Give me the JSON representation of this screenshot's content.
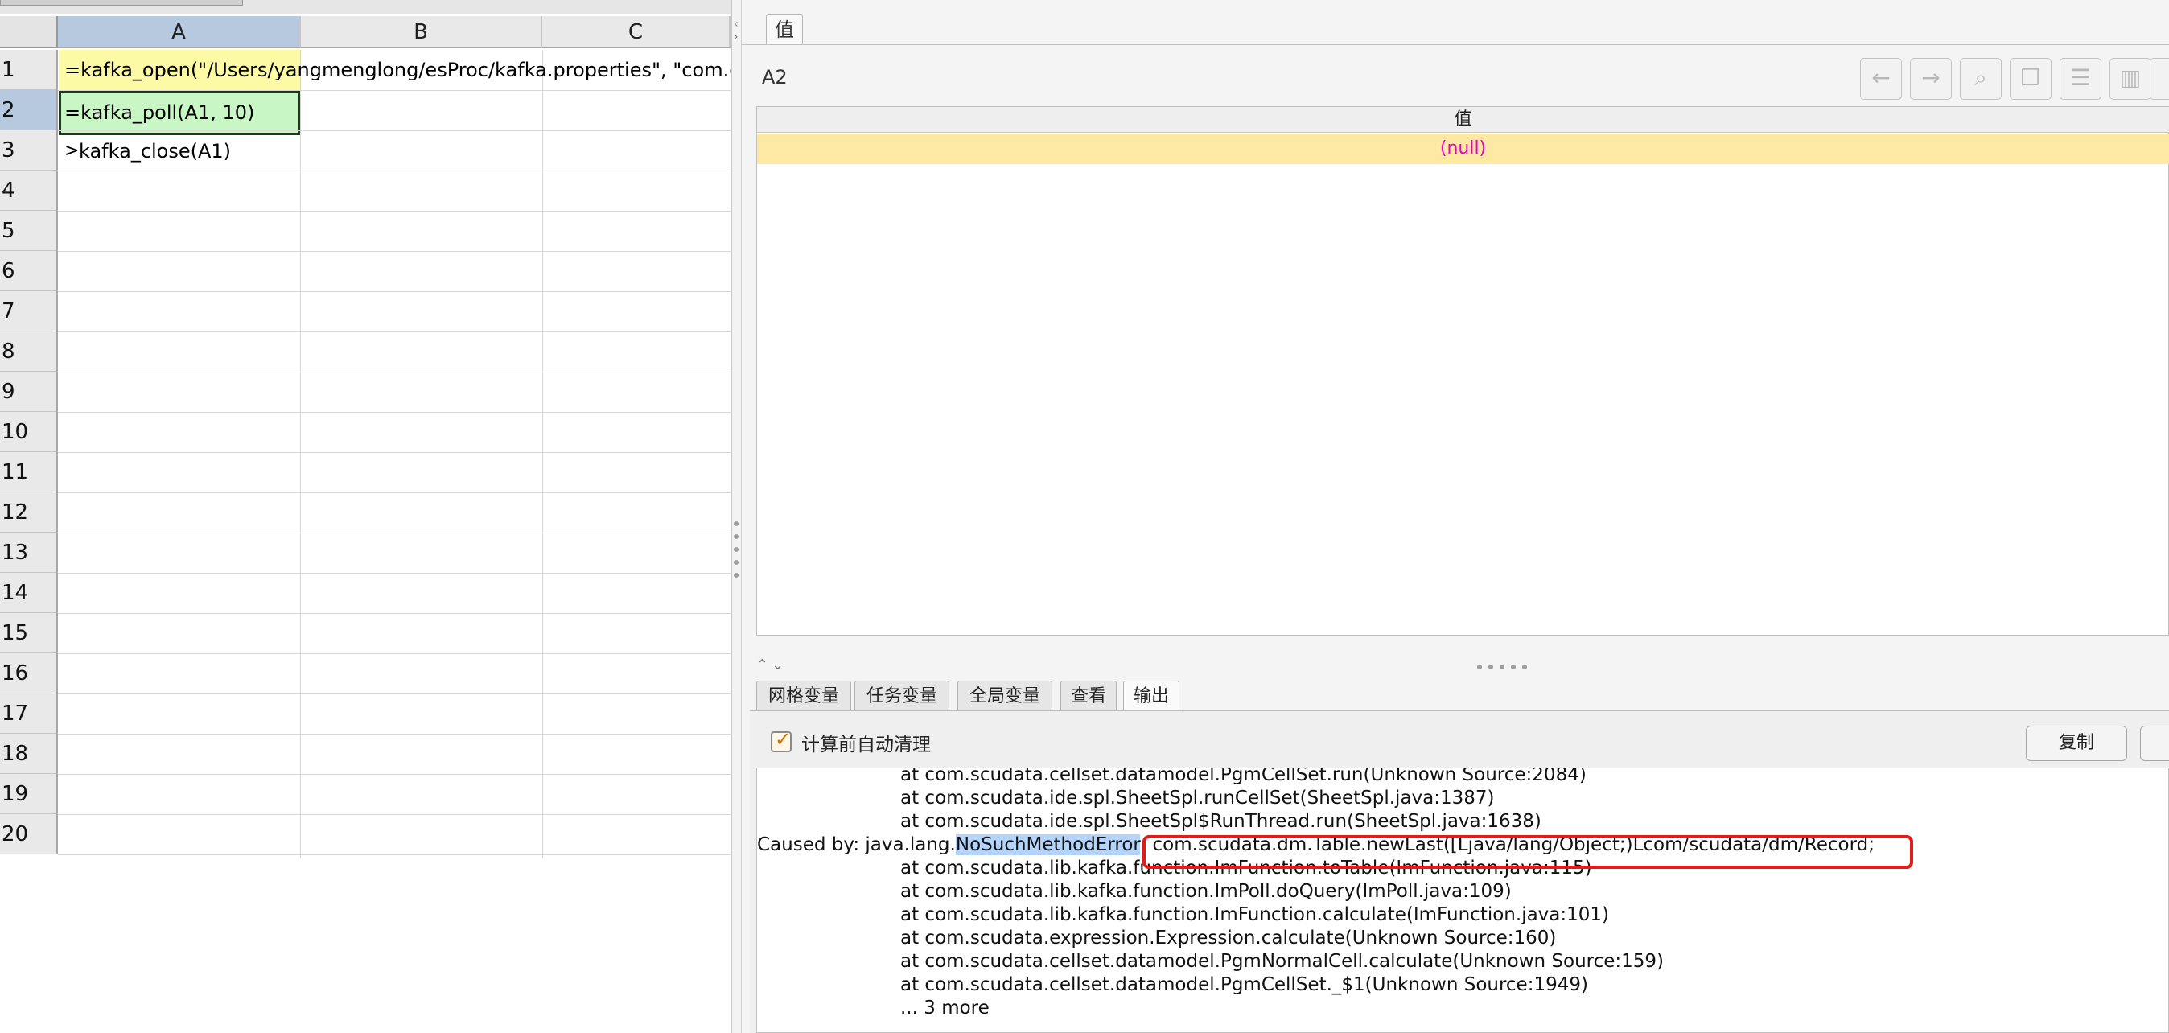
{
  "sheet": {
    "columns": [
      "A",
      "B",
      "C"
    ],
    "rows": [
      "1",
      "2",
      "3",
      "4",
      "5",
      "6",
      "7",
      "8",
      "9",
      "10",
      "11",
      "12",
      "13",
      "14",
      "15",
      "16",
      "17",
      "18",
      "19",
      "20"
    ],
    "cells": {
      "a1": "=kafka_open(\"/Users/yangmenglong/esProc/kafka.properties\", \"com.db",
      "a2": "=kafka_poll(A1, 10)",
      "a3_prefix": ">",
      "a3": "kafka_close(A1)"
    }
  },
  "value_panel": {
    "tab_label": "值",
    "cell_ref": "A2",
    "column_header": "值",
    "value": "(null)",
    "toolbar_icons": [
      "back-arrow-icon",
      "forward-arrow-icon",
      "search-icon",
      "copy-icon",
      "list-icon",
      "chart-icon",
      "more-icon"
    ]
  },
  "bottom_tabs": [
    "网格变量",
    "任务变量",
    "全局变量",
    "查看",
    "输出"
  ],
  "output": {
    "auto_clear_label": "计算前自动清理",
    "auto_clear_checked": true,
    "copy_label": "复制",
    "lines": [
      {
        "indent": true,
        "text": "at com.scudata.cellset.datamodel.PgmCellSet.run(Unknown Source:2084)"
      },
      {
        "indent": true,
        "text": "at com.scudata.ide.spl.SheetSpl.runCellSet(SheetSpl.java:1387)"
      },
      {
        "indent": true,
        "text": "at com.scudata.ide.spl.SheetSpl$RunThread.run(SheetSpl.java:1638)"
      },
      {
        "indent": false,
        "pre": "Caused by: java.lang.",
        "hl": "NoSuchMethodError",
        "post": ": com.scudata.dm.Table.newLast([Ljava/lang/Object;)Lcom/scudata/dm/Record;"
      },
      {
        "indent": true,
        "text": "at com.scudata.lib.kafka.function.ImFunction.toTable(ImFunction.java:115)"
      },
      {
        "indent": true,
        "text": "at com.scudata.lib.kafka.function.ImPoll.doQuery(ImPoll.java:109)"
      },
      {
        "indent": true,
        "text": "at com.scudata.lib.kafka.function.ImFunction.calculate(ImFunction.java:101)"
      },
      {
        "indent": true,
        "text": "at com.scudata.expression.Expression.calculate(Unknown Source:160)"
      },
      {
        "indent": true,
        "text": "at com.scudata.cellset.datamodel.PgmNormalCell.calculate(Unknown Source:159)"
      },
      {
        "indent": true,
        "text": "at com.scudata.cellset.datamodel.PgmCellSet._$1(Unknown Source:1949)"
      },
      {
        "indent": true,
        "text": "... 3 more"
      }
    ]
  },
  "colors": {
    "a1_bg": "#fdfaa6",
    "a2_bg": "#c8f7c5",
    "null_value": "#e800c8",
    "value_row_bg": "#fde9a4",
    "error_box": "#e21b1b",
    "highlight": "#b3d4fc"
  }
}
